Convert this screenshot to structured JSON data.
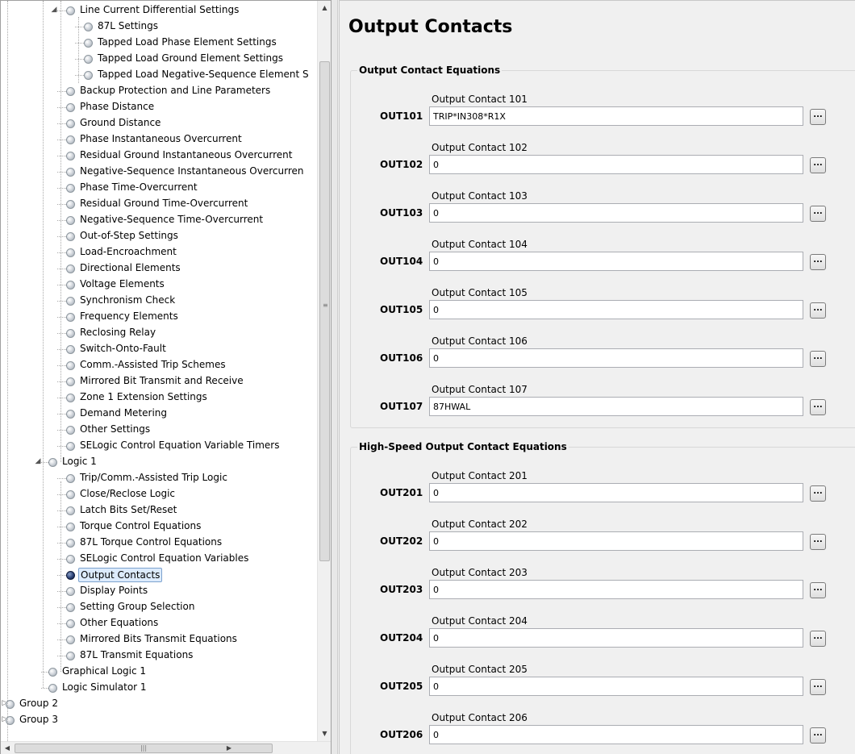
{
  "tree": {
    "items": [
      {
        "label": "Line Current Differential Settings",
        "level": 2,
        "expander": "open"
      },
      {
        "label": "87L Settings",
        "level": 3
      },
      {
        "label": "Tapped Load Phase Element Settings",
        "level": 3
      },
      {
        "label": "Tapped Load Ground Element Settings",
        "level": 3
      },
      {
        "label": "Tapped Load Negative-Sequence Element S",
        "level": 3
      },
      {
        "label": "Backup Protection and Line Parameters",
        "level": 2
      },
      {
        "label": "Phase Distance",
        "level": 2
      },
      {
        "label": "Ground Distance",
        "level": 2
      },
      {
        "label": "Phase Instantaneous Overcurrent",
        "level": 2
      },
      {
        "label": "Residual Ground Instantaneous Overcurrent",
        "level": 2
      },
      {
        "label": "Negative-Sequence Instantaneous Overcurren",
        "level": 2
      },
      {
        "label": "Phase Time-Overcurrent",
        "level": 2
      },
      {
        "label": "Residual Ground Time-Overcurrent",
        "level": 2
      },
      {
        "label": "Negative-Sequence Time-Overcurrent",
        "level": 2
      },
      {
        "label": "Out-of-Step Settings",
        "level": 2
      },
      {
        "label": "Load-Encroachment",
        "level": 2
      },
      {
        "label": "Directional Elements",
        "level": 2
      },
      {
        "label": "Voltage Elements",
        "level": 2
      },
      {
        "label": "Synchronism Check",
        "level": 2
      },
      {
        "label": "Frequency Elements",
        "level": 2
      },
      {
        "label": "Reclosing Relay",
        "level": 2
      },
      {
        "label": "Switch-Onto-Fault",
        "level": 2
      },
      {
        "label": "Comm.-Assisted Trip Schemes",
        "level": 2
      },
      {
        "label": "Mirrored Bit Transmit and Receive",
        "level": 2
      },
      {
        "label": "Zone 1 Extension Settings",
        "level": 2
      },
      {
        "label": "Demand Metering",
        "level": 2
      },
      {
        "label": "Other Settings",
        "level": 2
      },
      {
        "label": "SELogic Control Equation Variable Timers",
        "level": 2
      },
      {
        "label": "Logic 1",
        "level": 1,
        "expander": "open"
      },
      {
        "label": "Trip/Comm.-Assisted Trip Logic",
        "level": 2
      },
      {
        "label": "Close/Reclose Logic",
        "level": 2
      },
      {
        "label": "Latch Bits Set/Reset",
        "level": 2
      },
      {
        "label": "Torque Control Equations",
        "level": 2
      },
      {
        "label": "87L Torque Control Equations",
        "level": 2
      },
      {
        "label": "SELogic Control Equation Variables",
        "level": 2
      },
      {
        "label": "Output Contacts",
        "level": 2,
        "selected": true
      },
      {
        "label": "Display Points",
        "level": 2
      },
      {
        "label": "Setting Group Selection",
        "level": 2
      },
      {
        "label": "Other Equations",
        "level": 2
      },
      {
        "label": "Mirrored Bits Transmit Equations",
        "level": 2
      },
      {
        "label": "87L Transmit Equations",
        "level": 2
      },
      {
        "label": "Graphical Logic 1",
        "level": 1
      },
      {
        "label": "Logic Simulator 1",
        "level": 1
      },
      {
        "label": "Group 2",
        "level": 0,
        "expander": "closed"
      },
      {
        "label": "Group 3",
        "level": 0,
        "expander": "closed"
      }
    ]
  },
  "main": {
    "title": "Output Contacts",
    "groups": [
      {
        "title": "Output Contact Equations",
        "fields": [
          {
            "caption": "Output Contact 101",
            "label": "OUT101",
            "value": "TRIP*IN308*R1X"
          },
          {
            "caption": "Output Contact 102",
            "label": "OUT102",
            "value": "0"
          },
          {
            "caption": "Output Contact 103",
            "label": "OUT103",
            "value": "0"
          },
          {
            "caption": "Output Contact 104",
            "label": "OUT104",
            "value": "0"
          },
          {
            "caption": "Output Contact 105",
            "label": "OUT105",
            "value": "0"
          },
          {
            "caption": "Output Contact 106",
            "label": "OUT106",
            "value": "0"
          },
          {
            "caption": "Output Contact 107",
            "label": "OUT107",
            "value": "87HWAL"
          }
        ]
      },
      {
        "title": "High-Speed Output Contact Equations",
        "fields": [
          {
            "caption": "Output Contact 201",
            "label": "OUT201",
            "value": "0"
          },
          {
            "caption": "Output Contact 202",
            "label": "OUT202",
            "value": "0"
          },
          {
            "caption": "Output Contact 203",
            "label": "OUT203",
            "value": "0"
          },
          {
            "caption": "Output Contact 204",
            "label": "OUT204",
            "value": "0"
          },
          {
            "caption": "Output Contact 205",
            "label": "OUT205",
            "value": "0"
          },
          {
            "caption": "Output Contact 206",
            "label": "OUT206",
            "value": "0"
          }
        ]
      }
    ],
    "ellipsis_label": "..."
  }
}
